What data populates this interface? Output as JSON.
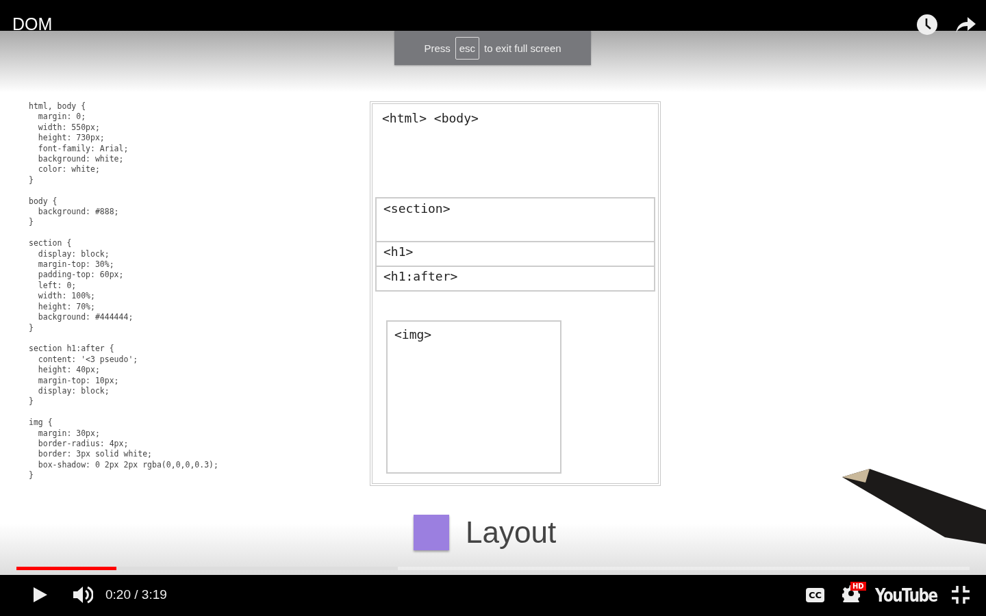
{
  "video_title": "DOM",
  "fullscreen_notice": {
    "before": "Press",
    "key": "esc",
    "after": "to exit full screen"
  },
  "code_blocks": [
    [
      "html, body {",
      "  margin: 0;",
      "  width: 550px;",
      "  height: 730px;",
      "  font-family: Arial;",
      "  background: white;",
      "  color: white;",
      "}"
    ],
    [
      "body {",
      "  background: #888;",
      "}"
    ],
    [
      "section {",
      "  display: block;",
      "  margin-top: 30%;",
      "  padding-top: 60px;",
      "  left: 0;",
      "  width: 100%;",
      "  height: 70%;",
      "  background: #444444;",
      "}"
    ],
    [
      "section h1:after {",
      "  content: '<3 pseudo';",
      "  height: 40px;",
      "  margin-top: 10px;",
      "  display: block;",
      "}"
    ],
    [
      "img {",
      "  margin: 30px;",
      "  border-radius: 4px;",
      "  border: 3px solid white;",
      "  box-shadow: 0 2px 2px rgba(0,0,0,0.3);",
      "}"
    ]
  ],
  "diagram": {
    "boxes": [
      {
        "kind": "root",
        "label": "<html> <body>"
      },
      {
        "kind": "section",
        "label": "<section>"
      },
      {
        "kind": "row",
        "label": "<h1>"
      },
      {
        "kind": "row",
        "label": "<h1:after>"
      },
      {
        "kind": "image",
        "label": "<img>"
      }
    ]
  },
  "legend": {
    "label": "Layout",
    "color": "#9b7fe0"
  },
  "progress": {
    "level": 0.105,
    "buffer": {
      "level": 0.4
    }
  },
  "controls": {
    "playing": false,
    "time": "0:20 / 3:19",
    "captions": "CC",
    "quality": "HD",
    "logo": "YouTube"
  }
}
